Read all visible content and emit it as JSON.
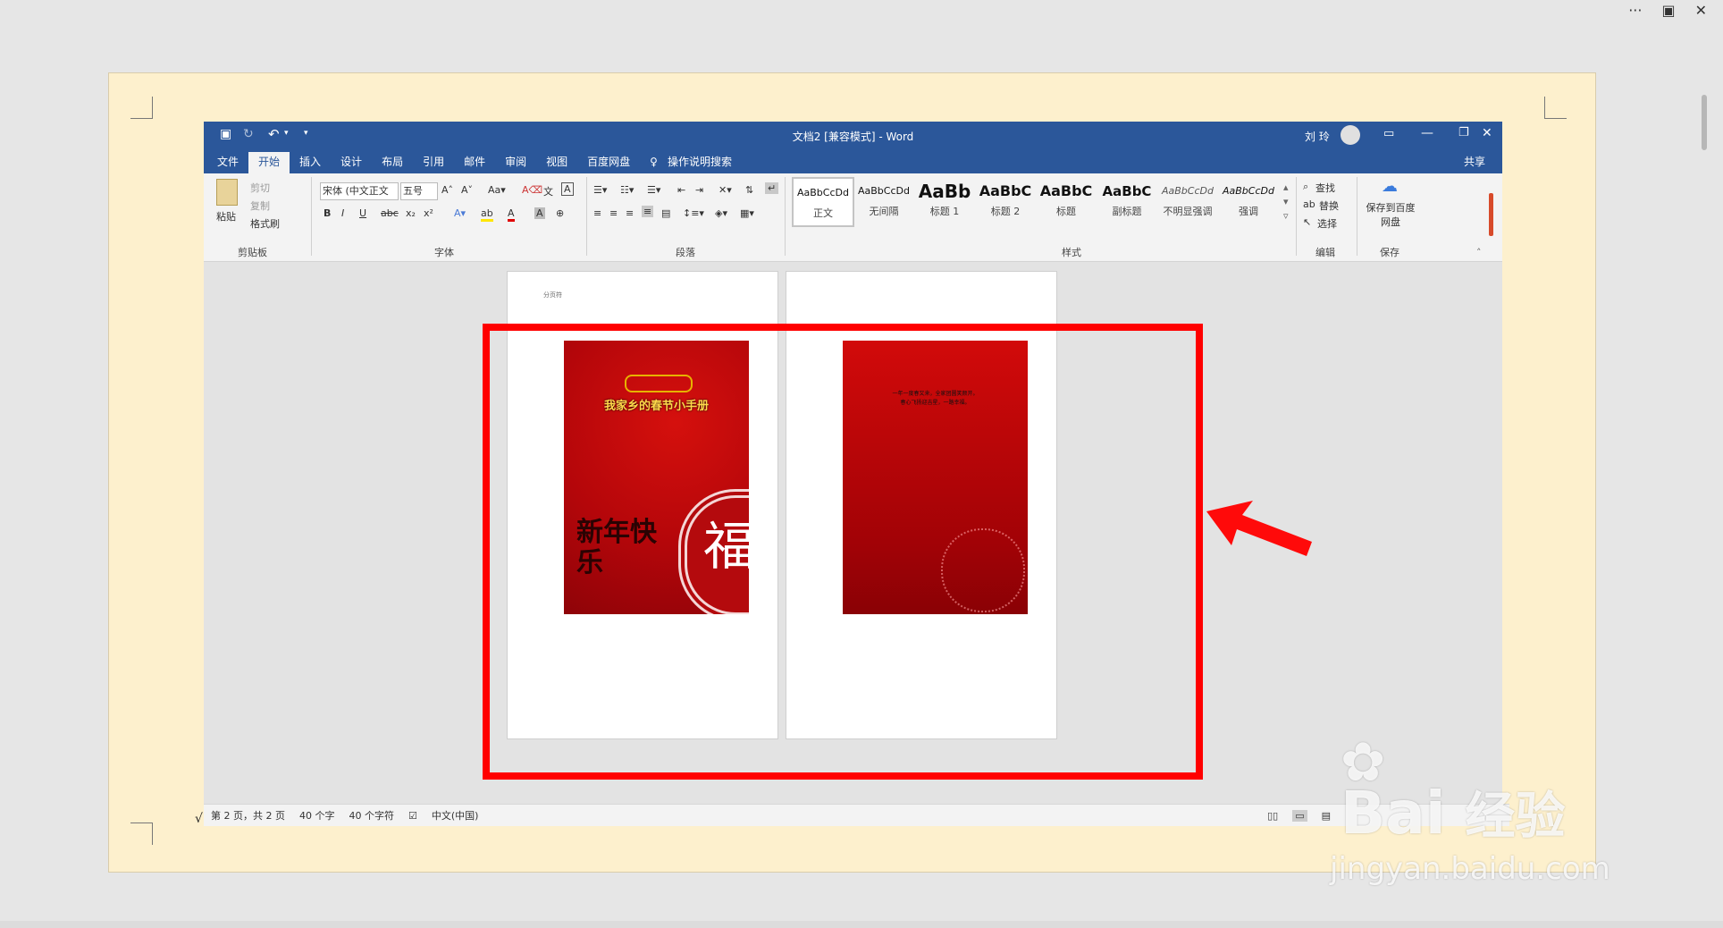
{
  "title": {
    "doc_name": "文档2 [兼容模式] - Word",
    "user": "刘 玲"
  },
  "quick_access": {
    "save_icon": "save-icon",
    "undo_icon": "undo-icon"
  },
  "tabs": [
    "文件",
    "开始",
    "插入",
    "设计",
    "布局",
    "引用",
    "邮件",
    "审阅",
    "视图",
    "百度网盘"
  ],
  "active_tab": "开始",
  "tell_me": "操作说明搜索",
  "share": "共享",
  "clipboard": {
    "paste": "粘贴",
    "cut": "剪切",
    "copy": "复制",
    "format_painter": "格式刷",
    "group": "剪贴板"
  },
  "font": {
    "name": "宋体 (中文正文",
    "size": "五号",
    "group": "字体"
  },
  "paragraph": {
    "group": "段落"
  },
  "styles": {
    "items": [
      {
        "preview": "AaBbCcDd",
        "name": "正文"
      },
      {
        "preview": "AaBbCcDd",
        "name": "无间隔"
      },
      {
        "preview": "AaBb",
        "name": "标题 1"
      },
      {
        "preview": "AaBbC",
        "name": "标题 2"
      },
      {
        "preview": "AaBbC",
        "name": "标题"
      },
      {
        "preview": "AaBbC",
        "name": "副标题"
      },
      {
        "preview": "AaBbCcDd",
        "name": "不明显强调"
      },
      {
        "preview": "AaBbCcDd",
        "name": "强调"
      }
    ],
    "group": "样式"
  },
  "editing": {
    "find": "查找",
    "replace": "替换",
    "select": "选择",
    "group": "编辑"
  },
  "save_group": {
    "button": "保存到百度网盘",
    "group": "保存"
  },
  "document": {
    "section_mark": "分页符",
    "cover_title": "我家乡的春节小手册",
    "calligraphy": "新年快乐",
    "fu": "福",
    "page2_line1": "一年一度春又来，全家团圆笑颜开。",
    "page2_line2": "春心飞扬迎吉星，一路幸福。"
  },
  "status": {
    "page": "第 2 页，共 2 页",
    "words": "40 个字",
    "chars": "40 个字符",
    "lang": "中文(中国)"
  },
  "watermark": {
    "brand": "Bai",
    "brand2": "经验",
    "url": "jingyan.baidu.com"
  },
  "colors": {
    "ribbon_blue": "#2b579a",
    "highlight": "#ff0000",
    "cover_red": "#c00000"
  }
}
